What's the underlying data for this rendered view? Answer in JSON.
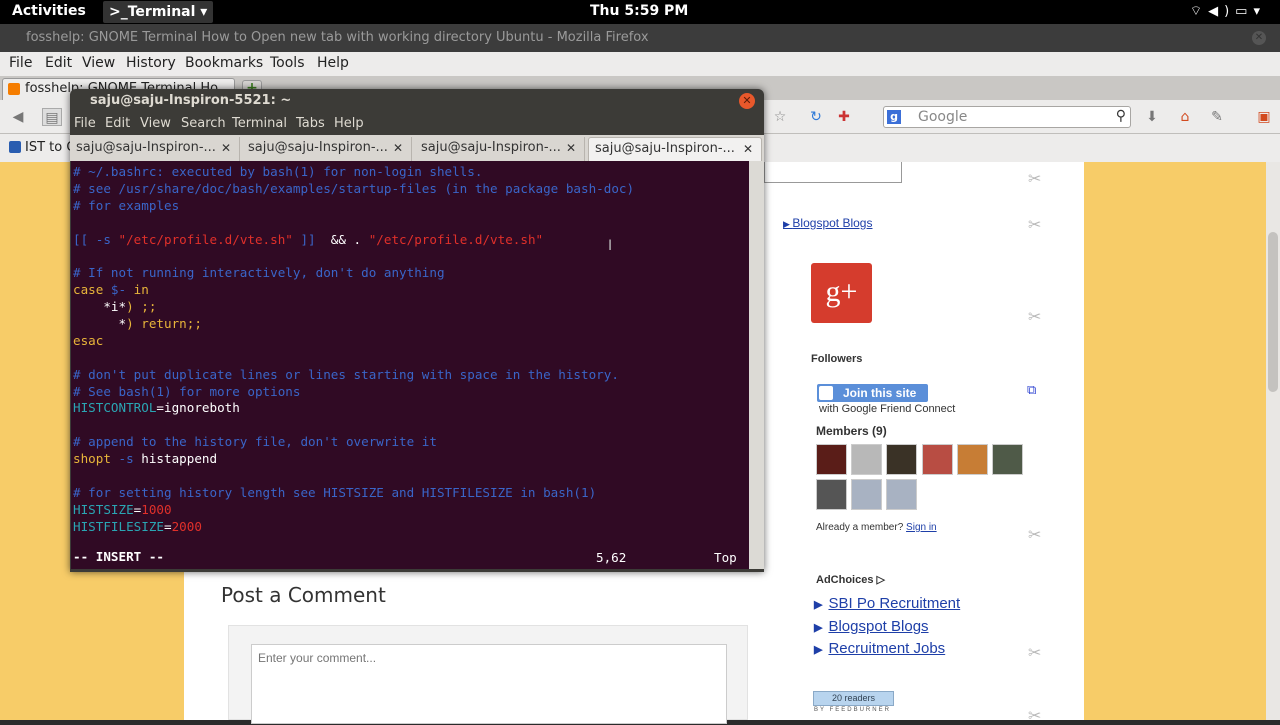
{
  "topbar": {
    "activities": "Activities",
    "app_menu": "Terminal",
    "clock": "Thu  5:59 PM"
  },
  "firefox": {
    "window_title": "fosshelp: GNOME Terminal How to Open new tab with working directory Ubuntu - Mozilla Firefox",
    "menu": [
      "File",
      "Edit",
      "View",
      "History",
      "Bookmarks",
      "Tools",
      "Help"
    ],
    "tab_title": "fosshelp: GNOME Terminal Ho",
    "search_placeholder": "Google",
    "bookmark": "IST to C"
  },
  "page": {
    "blogspot_link": "Blogspot Blogs",
    "followers_title": "Followers",
    "join_button": "Join this site",
    "gfc_text": "with Google Friend Connect",
    "members_title": "Members (9)",
    "already_member": "Already a member?",
    "sign_in": "Sign in",
    "adchoices": "AdChoices",
    "ads": [
      "SBI Po Recruitment",
      "Blogspot Blogs",
      "Recruitment Jobs"
    ],
    "post_comment_title": "Post a Comment",
    "comment_placeholder": "Enter your comment...",
    "readers_count": "20",
    "readers_label": "readers",
    "feedburner": "BY FEEDBURNER"
  },
  "terminal": {
    "title": "saju@saju-Inspiron-5521: ~",
    "menu": [
      "File",
      "Edit",
      "View",
      "Search",
      "Terminal",
      "Tabs",
      "Help"
    ],
    "tabs": [
      "saju@saju-Inspiron-...",
      "saju@saju-Inspiron-...",
      "saju@saju-Inspiron-...",
      "saju@saju-Inspiron-..."
    ],
    "lines": [
      [
        [
          "cm",
          "# ~/.bashrc: executed by bash(1) for non-login shells."
        ]
      ],
      [
        [
          "cm",
          "# see /usr/share/doc/bash/examples/startup-files (in the package bash-doc)"
        ]
      ],
      [
        [
          "cm",
          "# for examples"
        ]
      ],
      [],
      [
        [
          "cm",
          "[[ -s "
        ],
        [
          "st",
          "\"/etc/profile.d/vte.sh\""
        ],
        [
          "cm",
          " ]]"
        ],
        [
          "",
          "  && . "
        ],
        [
          "st",
          "\"/etc/profile.d/vte.sh\""
        ]
      ],
      [],
      [
        [
          "cm",
          "# If not running interactively, don't do anything"
        ]
      ],
      [
        [
          "kw",
          "case "
        ],
        [
          "cm",
          "$-"
        ],
        [
          "kw",
          " in"
        ]
      ],
      [
        [
          "",
          "    *i*"
        ],
        [
          "kw",
          ") ;;"
        ]
      ],
      [
        [
          "",
          "      *"
        ],
        [
          "kw",
          ") return;;"
        ]
      ],
      [
        [
          "kw",
          "esac"
        ]
      ],
      [],
      [
        [
          "cm",
          "# don't put duplicate lines or lines starting with space in the history."
        ]
      ],
      [
        [
          "cm",
          "# See bash(1) for more options"
        ]
      ],
      [
        [
          "vr",
          "HISTCONTROL"
        ],
        [
          "",
          "=ignoreboth"
        ]
      ],
      [],
      [
        [
          "cm",
          "# append to the history file, don't overwrite it"
        ]
      ],
      [
        [
          "kw",
          "shopt "
        ],
        [
          "cm",
          "-s"
        ],
        [
          "",
          " histappend"
        ]
      ],
      [],
      [
        [
          "cm",
          "# for setting history length see HISTSIZE and HISTFILESIZE in bash(1)"
        ]
      ],
      [
        [
          "vr",
          "HISTSIZE"
        ],
        [
          "",
          "="
        ],
        [
          "nm",
          "1000"
        ]
      ],
      [
        [
          "vr",
          "HISTFILESIZE"
        ],
        [
          "",
          "="
        ],
        [
          "nm",
          "2000"
        ]
      ]
    ],
    "mode": "-- INSERT --",
    "position": "5,62",
    "scroll_pos": "Top"
  }
}
